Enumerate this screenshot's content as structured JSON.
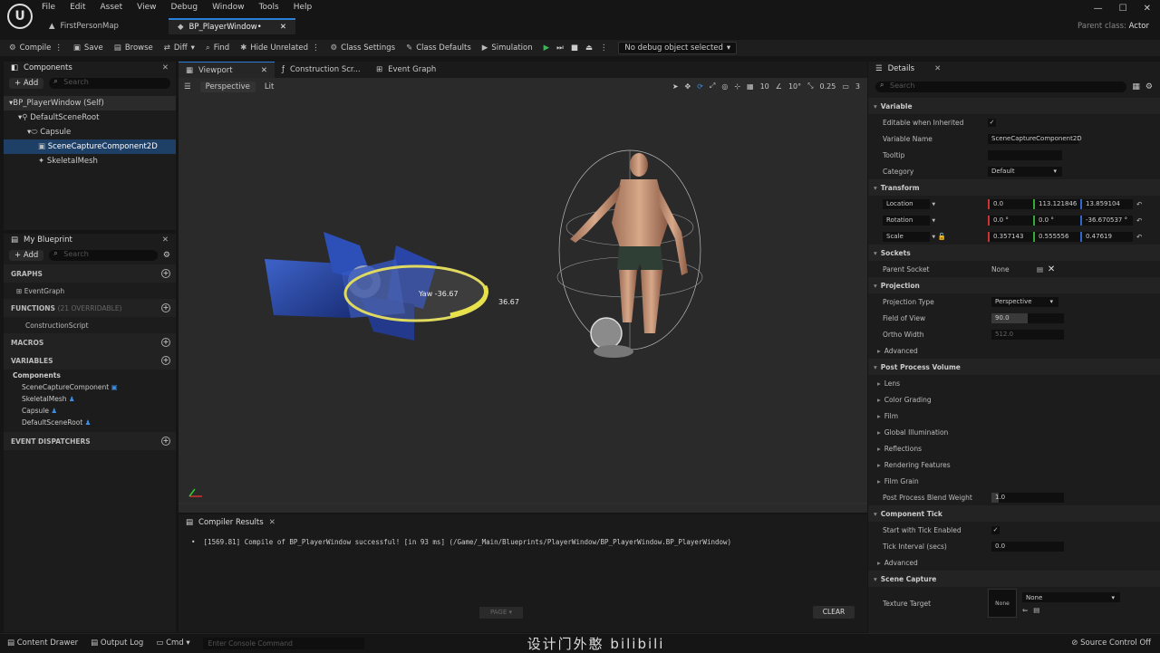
{
  "menu": [
    "File",
    "Edit",
    "Asset",
    "View",
    "Debug",
    "Window",
    "Tools",
    "Help"
  ],
  "tabs": {
    "map": "FirstPersonMap",
    "bp": "BP_PlayerWindow•"
  },
  "parent_class": {
    "label": "Parent class:",
    "value": "Actor"
  },
  "toolbar": {
    "compile": "Compile",
    "save": "Save",
    "browse": "Browse",
    "diff": "Diff",
    "find": "Find",
    "hide": "Hide Unrelated",
    "class_settings": "Class Settings",
    "class_defaults": "Class Defaults",
    "simulation": "Simulation",
    "debug": "No debug object selected"
  },
  "components": {
    "title": "Components",
    "add": "Add",
    "search": "Search",
    "tree": [
      "BP_PlayerWindow (Self)",
      "DefaultSceneRoot",
      "Capsule",
      "SceneCaptureComponent2D",
      "SkeletalMesh"
    ]
  },
  "my_blueprint": {
    "title": "My Blueprint",
    "add": "Add",
    "search": "Search",
    "graphs": "GRAPHS",
    "event_graph": "EventGraph",
    "functions": "FUNCTIONS",
    "functions_note": "(21 OVERRIDABLE)",
    "construction": "ConstructionScript",
    "macros": "MACROS",
    "variables": "VARIABLES",
    "components_label": "Components",
    "vars": [
      "SceneCaptureComponent",
      "SkeletalMesh",
      "Capsule",
      "DefaultSceneRoot"
    ],
    "dispatchers": "EVENT DISPATCHERS"
  },
  "viewport_tabs": [
    "Viewport",
    "Construction Scr...",
    "Event Graph"
  ],
  "viewport": {
    "perspective": "Perspective",
    "lit": "Lit",
    "grid": "10",
    "angle": "10°",
    "scale": "0.25",
    "cam": "3",
    "yaw_label": "Yaw -36.67",
    "yaw_value": "36.67"
  },
  "compiler": {
    "title": "Compiler Results",
    "message": "[1569.81] Compile of BP_PlayerWindow successful! [in 93 ms] (/Game/_Main/Blueprints/PlayerWindow/BP_PlayerWindow.BP_PlayerWindow)",
    "page": "PAGE",
    "clear": "CLEAR"
  },
  "details": {
    "title": "Details",
    "search": "Search",
    "variable": "Variable",
    "editable": "Editable when Inherited",
    "var_name_label": "Variable Name",
    "var_name": "SceneCaptureComponent2D",
    "tooltip": "Tooltip",
    "category_label": "Category",
    "category": "Default",
    "transform": "Transform",
    "location": "Location",
    "loc": [
      "0.0",
      "113.121846",
      "13.859104"
    ],
    "rotation": "Rotation",
    "rot": [
      "0.0 °",
      "0.0 °",
      "-36.670537 °"
    ],
    "scale": "Scale",
    "scl": [
      "0.357143",
      "0.555556",
      "0.47619"
    ],
    "sockets": "Sockets",
    "parent_socket": "Parent Socket",
    "socket_val": "None",
    "projection": "Projection",
    "proj_type_label": "Projection Type",
    "proj_type": "Perspective",
    "fov_label": "Field of View",
    "fov": "90.0",
    "ortho_label": "Ortho Width",
    "ortho": "512.0",
    "advanced": "Advanced",
    "ppv": "Post Process Volume",
    "pp_items": [
      "Lens",
      "Color Grading",
      "Film",
      "Global Illumination",
      "Reflections",
      "Rendering Features",
      "Film Grain"
    ],
    "blend_label": "Post Process Blend Weight",
    "blend": "1.0",
    "comp_tick": "Component Tick",
    "tick_enabled": "Start with Tick Enabled",
    "tick_interval": "Tick Interval (secs)",
    "tick_val": "0.0",
    "advanced2": "Advanced",
    "scene_capture": "Scene Capture",
    "texture_target": "Texture Target",
    "tt_val": "None",
    "tt_thumb": "None"
  },
  "bottom": {
    "drawer": "Content Drawer",
    "output": "Output Log",
    "cmd": "Cmd",
    "console": "Enter Console Command",
    "watermark": "设计门外憨 bilibili",
    "source": "Source Control Off"
  }
}
